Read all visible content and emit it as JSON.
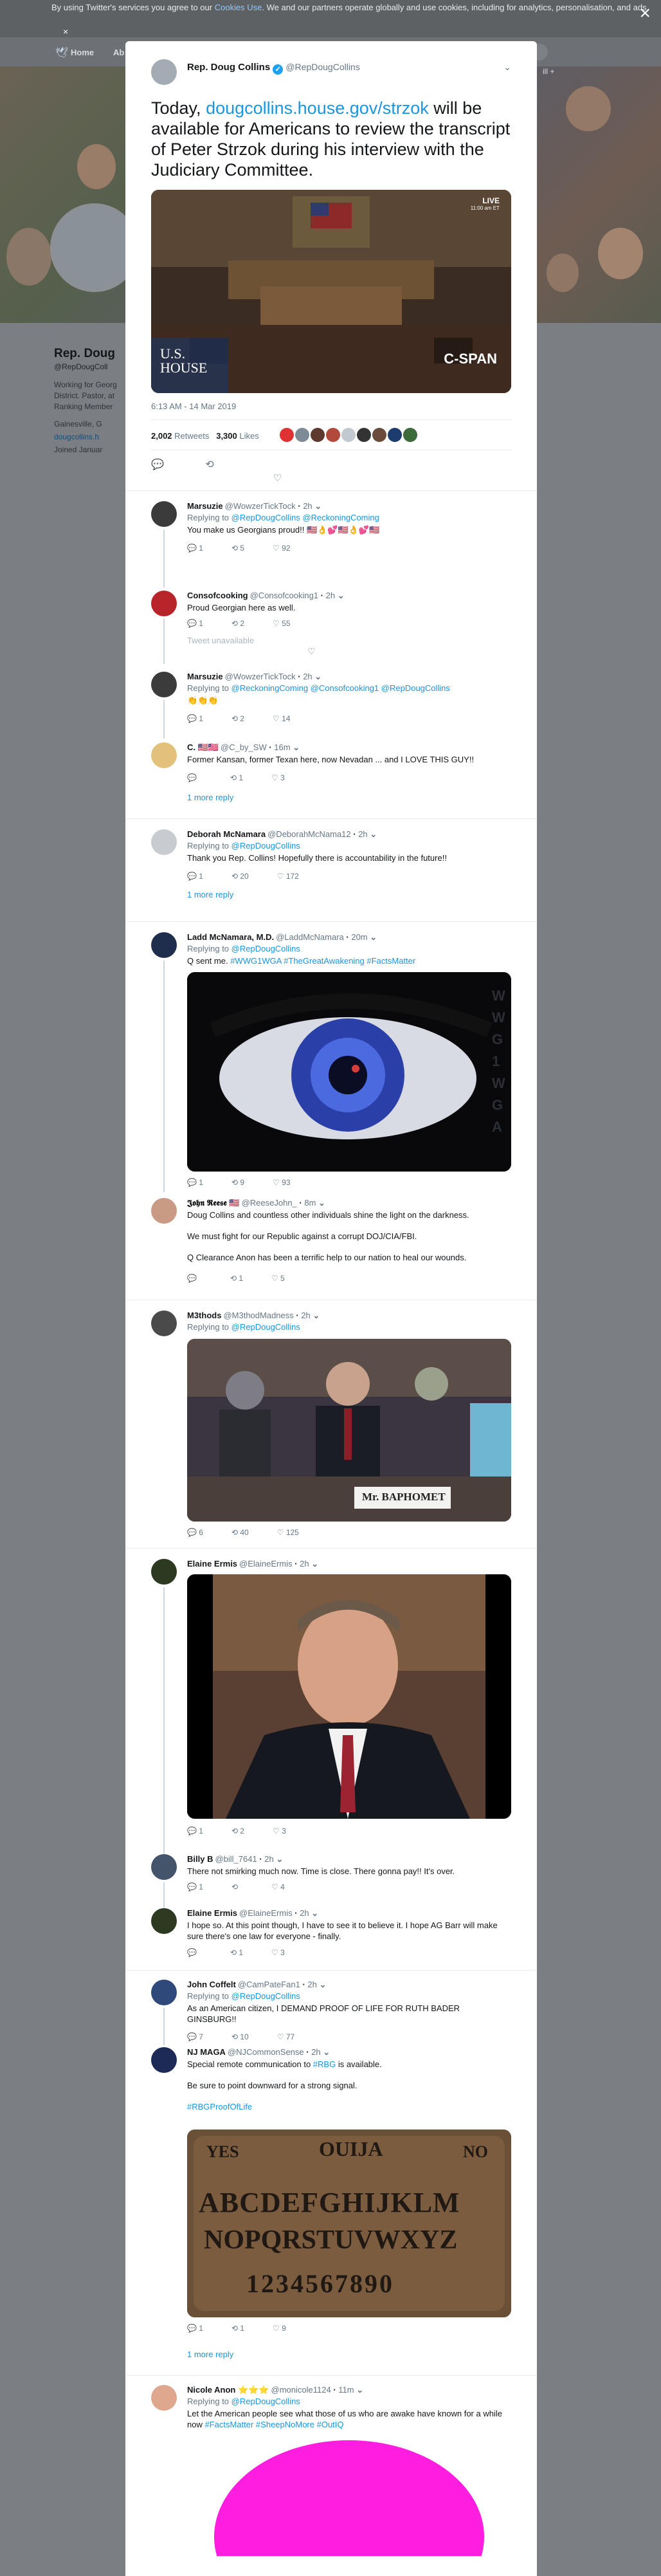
{
  "cookie": {
    "text": "By using Twitter's services you agree to our",
    "link": "Cookies Use",
    "text2": ". We and our partners operate globally and use cookies, including for analytics, personalisation, and ads",
    "close": "×"
  },
  "bgnav": {
    "home": "Home",
    "about": "Ab",
    "search_icon": "search-icon",
    "right": "ill +"
  },
  "bgprofile": {
    "name": "Rep. Doug",
    "handle": "@RepDougColl",
    "bio": "Working for Georg District. Pastor, at Ranking Member",
    "loc": "Gainesville, G",
    "site": "dougcollins.h",
    "joined": "Joined Januar"
  },
  "modal": {
    "close": "×",
    "name": "Rep. Doug Collins",
    "handle": "@RepDougCollins",
    "text_before": "Today, ",
    "link": "dougcollins.house.gov/strzok",
    "text_after": " will be available for Americans to review the transcript of Peter Strzok during his interview with the Judiciary Committee.",
    "video": {
      "live": "LIVE",
      "live_time": "11:00 am ET",
      "logo_top": "U.S.",
      "logo_bottom": "HOUSE",
      "cspan": "C-SPAN"
    },
    "timestamp": "6:13 AM - 14 Mar 2019",
    "retweets": "2,002",
    "retweets_label": "Retweets",
    "likes": "3,300",
    "likes_label": "Likes"
  },
  "replies": [
    {
      "name": "Marsuzie",
      "handle": "@WowzerTickTock",
      "time": "2h",
      "to": "Replying to",
      "to1": "@RepDougCollins",
      "to2": "@ReckoningComing",
      "text": "You make us Georgians proud!! 🇺🇸👌💕🇺🇸👌💕🇺🇸",
      "reply": "1",
      "rt": "5",
      "like": "92"
    },
    {
      "name": "Consofcooking",
      "handle": "@Consofcooking1",
      "time": "2h",
      "text": "Proud Georgian here as well.",
      "reply": "1",
      "rt": "2",
      "like": "55",
      "unav": "Tweet unavailable"
    },
    {
      "name": "Marsuzie",
      "handle": "@WowzerTickTock",
      "time": "2h",
      "to": "Replying to",
      "to1": "@ReckoningComing",
      "to2": "@Consofcooking1",
      "to3": "@RepDougCollins",
      "text": "👏👏👏",
      "reply": "1",
      "rt": "2",
      "like": "14"
    },
    {
      "name": "C. 🇺🇸🇱🇷",
      "handle": "@C_by_SW",
      "time": "16m",
      "text": "Former Kansan, former Texan here, now Nevadan ... and I LOVE THIS GUY!!",
      "reply": "",
      "rt": "1",
      "like": "3",
      "more": "1 more reply"
    },
    {
      "name": "Deborah McNamara",
      "handle": "@DeborahMcNama12",
      "time": "2h",
      "to": "Replying to",
      "to1": "@RepDougCollins",
      "text": "Thank you Rep. Collins! Hopefully there is accountability in the future!!",
      "reply": "1",
      "rt": "20",
      "like": "172",
      "more": "1 more reply"
    },
    {
      "name": "Ladd McNamara, M.D.",
      "handle": "@LaddMcNamara",
      "time": "20m",
      "to": "Replying to",
      "to1": "@RepDougCollins",
      "text": "Q sent me. ",
      "tags": "#WWG1WGA #TheGreatAwakening #FactsMatter",
      "img_text": "WWG1WGA",
      "reply": "1",
      "rt": "9",
      "like": "93"
    },
    {
      "name": "𝕵𝖔𝖍𝖓 𝕽𝖊𝖊𝖘𝖊 🇺🇸",
      "handle": "@ReeseJohn_",
      "time": "8m",
      "text": "Doug Collins and countless other individuals shine the light on the darkness.",
      "text2": "We must fight for our Republic against a corrupt DOJ/CIA/FBI.",
      "text3": "Q Clearance Anon has been a terrific help to our nation to heal our wounds.",
      "reply": "",
      "rt": "1",
      "like": "5"
    },
    {
      "name": "M3thods",
      "handle": "@M3thodMadness",
      "time": "2h",
      "to": "Replying to",
      "to1": "@RepDougCollins",
      "placard": "Mr. BAPHOMET",
      "reply": "6",
      "rt": "40",
      "like": "125"
    },
    {
      "name": "Elaine Ermis",
      "handle": "@ElaineErmis",
      "time": "2h",
      "reply": "1",
      "rt": "2",
      "like": "3"
    },
    {
      "name": "Billy B",
      "handle": "@bill_7641",
      "time": "2h",
      "text": "There not smirking much now. Time is close. There gonna pay!! It's over.",
      "reply": "1",
      "rt": "",
      "like": "4"
    },
    {
      "name": "Elaine Ermis",
      "handle": "@ElaineErmis",
      "time": "2h",
      "text": "I hope so. At this point though, I have to see it to believe it. I hope AG Barr will make sure there's one law for everyone - finally.",
      "reply": "",
      "rt": "1",
      "like": "3"
    },
    {
      "name": "John Coffelt",
      "handle": "@CamPateFan1",
      "time": "2h",
      "to": "Replying to",
      "to1": "@RepDougCollins",
      "text": "As an American citizen, I DEMAND PROOF OF LIFE FOR RUTH BADER GINSBURG!!",
      "reply": "7",
      "rt": "10",
      "like": "77"
    },
    {
      "name": "NJ MAGA",
      "handle": "@NJCommonSense",
      "time": "2h",
      "text": "Special remote communication to ",
      "tag": "#RBG",
      "text_b": " is available.",
      "text2": "Be sure to point downward for a strong signal.",
      "text3": "#RBGProofOfLife",
      "ouija": {
        "title": "OUIJA",
        "yes": "YES",
        "no": "NO",
        "row1": "ABCDEFGHIJKLM",
        "row2": "NOPQRSTUVWXYZ",
        "row3": "1234567890"
      },
      "reply": "1",
      "rt": "1",
      "like": "9",
      "more": "1 more reply"
    },
    {
      "name": "Nicole Anon ⭐⭐⭐",
      "handle": "@monicole1124",
      "time": "11m",
      "to": "Replying to",
      "to1": "@RepDougCollins",
      "text": "Let the American people see what those of us who are awake have known for a while now ",
      "tags": "#FactsMatter #SheepNoMore #OutIQ"
    }
  ]
}
